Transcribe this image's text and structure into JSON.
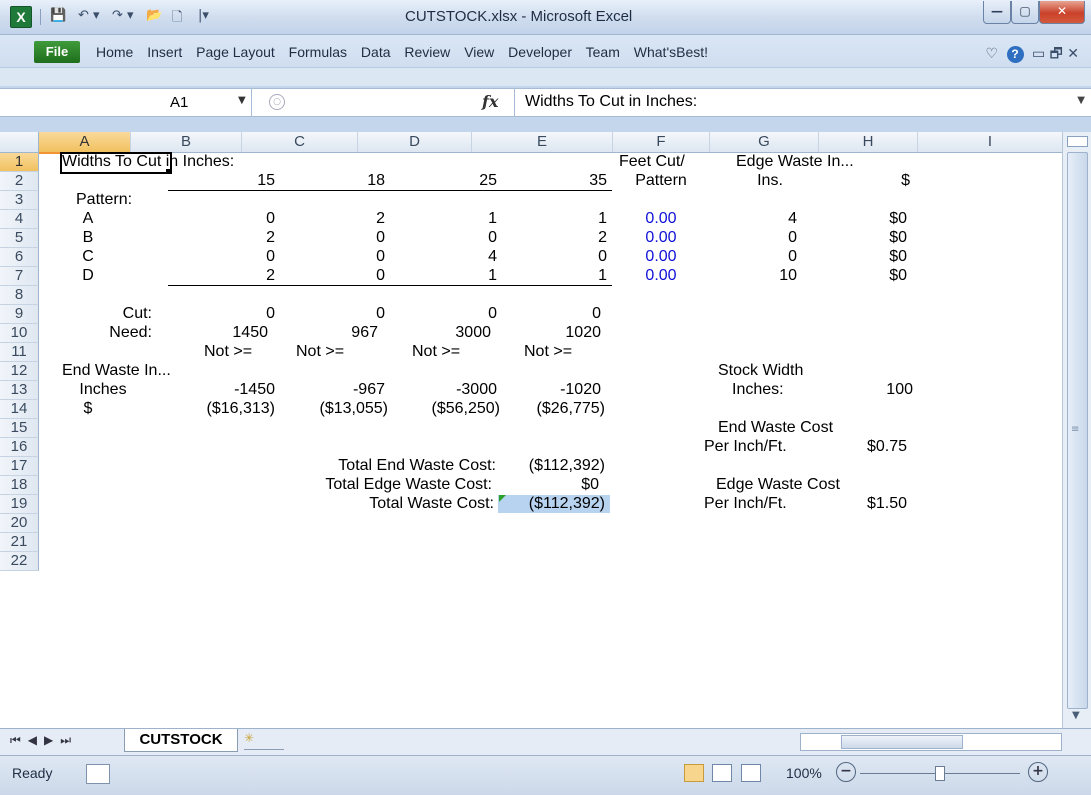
{
  "window": {
    "title": "CUTSTOCK.xlsx - Microsoft Excel",
    "app_icon": "X",
    "qat_icons": [
      "save-icon",
      "undo-icon",
      "redo-icon",
      "open-icon",
      "new-icon",
      "customize-icon"
    ],
    "buttons": {
      "minimize": "—",
      "maximize": "▢",
      "close": "✕"
    }
  },
  "ribbon": {
    "file_tab": "File",
    "tabs": [
      "Home",
      "Insert",
      "Page Layout",
      "Formulas",
      "Data",
      "Review",
      "View",
      "Developer",
      "Team",
      "What'sBest!"
    ],
    "right_icons": {
      "heart": "♡",
      "help": "?",
      "minimize": "▭",
      "restore": "🗗",
      "close": "✕"
    }
  },
  "formula_bar": {
    "name_box": "A1",
    "fx": "fx",
    "formula": "Widths To Cut in Inches:"
  },
  "columns": [
    "A",
    "B",
    "C",
    "D",
    "E",
    "F",
    "G",
    "H",
    "I"
  ],
  "selected_column": "A",
  "rows": [
    "1",
    "2",
    "3",
    "4",
    "5",
    "6",
    "7",
    "8",
    "9",
    "10",
    "11",
    "12",
    "13",
    "14",
    "15",
    "16",
    "17",
    "18",
    "19",
    "20",
    "21",
    "22"
  ],
  "selected_row": "1",
  "cells": {
    "r1": {
      "a": "Widths To Cut in Inches:",
      "f": "Feet Cut/",
      "g": "Edge Waste In..."
    },
    "r2": {
      "b": "15",
      "c": "18",
      "d": "25",
      "e": "35",
      "f": "Pattern",
      "g": "Ins.",
      "h": "$"
    },
    "r3": {
      "a": "Pattern:"
    },
    "pattern_rows": [
      {
        "label": "A",
        "b": "0",
        "c": "2",
        "d": "1",
        "e": "1",
        "f": "0.00",
        "g": "4",
        "h": "$0"
      },
      {
        "label": "B",
        "b": "2",
        "c": "0",
        "d": "0",
        "e": "2",
        "f": "0.00",
        "g": "0",
        "h": "$0"
      },
      {
        "label": "C",
        "b": "0",
        "c": "0",
        "d": "4",
        "e": "0",
        "f": "0.00",
        "g": "0",
        "h": "$0"
      },
      {
        "label": "D",
        "b": "2",
        "c": "0",
        "d": "1",
        "e": "1",
        "f": "0.00",
        "g": "10",
        "h": "$0"
      }
    ],
    "r9": {
      "a": "Cut:",
      "b": "0",
      "c": "0",
      "d": "0",
      "e": "0"
    },
    "r10": {
      "a": "Need:",
      "b": "1450",
      "c": "967",
      "d": "3000",
      "e": "1020"
    },
    "r11": {
      "b": "Not >=",
      "c": "Not >=",
      "d": "Not >=",
      "e": "Not >="
    },
    "r12": {
      "a": "End Waste In...",
      "g": "Stock Width"
    },
    "r13": {
      "a": "Inches",
      "b": "-1450",
      "c": "-967",
      "d": "-3000",
      "e": "-1020",
      "g": "Inches:",
      "h": "100"
    },
    "r14": {
      "a": "$",
      "b": "($16,313)",
      "c": "($13,055)",
      "d": "($56,250)",
      "e": "($26,775)"
    },
    "r15": {
      "g": "End Waste Cost"
    },
    "r16": {
      "g": "Per Inch/Ft.",
      "h": "$0.75"
    },
    "r17": {
      "label": "Total End Waste Cost:",
      "e": "($112,392)"
    },
    "r18": {
      "label": "Total Edge Waste Cost:",
      "e": "$0",
      "g": "Edge Waste Cost"
    },
    "r19": {
      "label": "Total Waste Cost:",
      "e": "($112,392)",
      "g": "Per Inch/Ft.",
      "h": "$1.50"
    }
  },
  "sheet_tabs": {
    "active": "CUTSTOCK"
  },
  "status": {
    "ready": "Ready",
    "zoom": "100%"
  },
  "colors": {
    "blue_values": "#1010d8",
    "selection_highlight": "#b7d3ef",
    "header_selected": "#f1c15f"
  }
}
